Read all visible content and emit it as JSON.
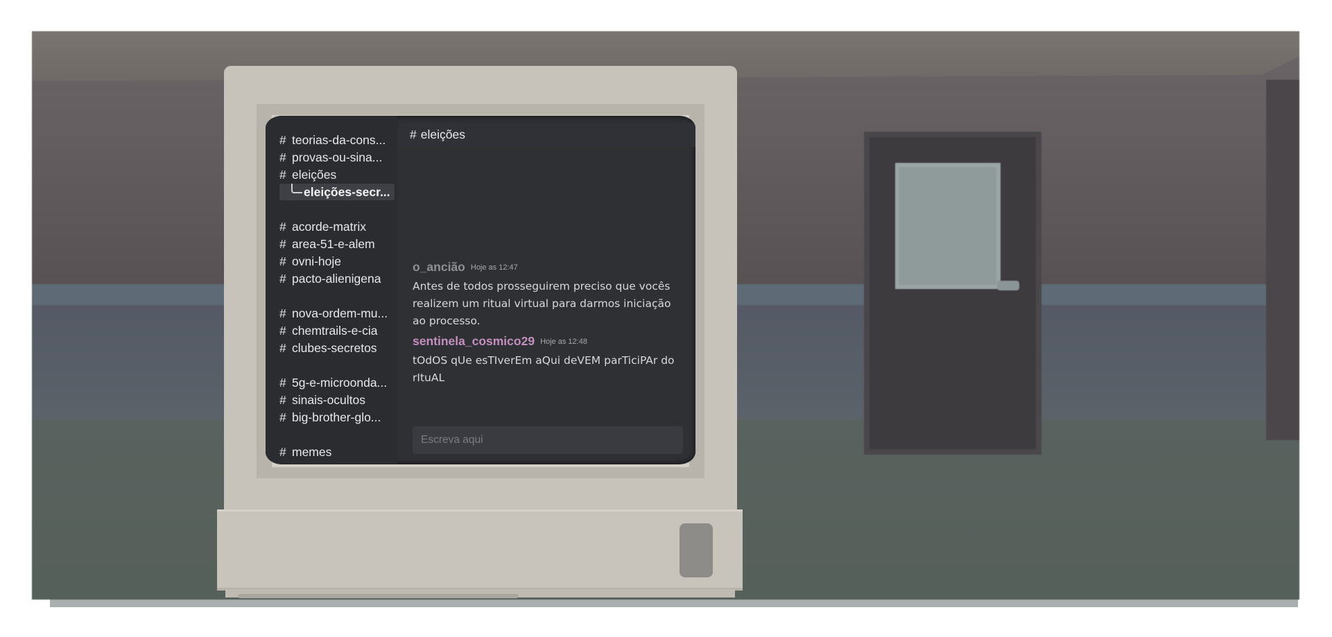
{
  "sidebar": {
    "channels": [
      {
        "hash": "#",
        "label": "teorias-da-cons..."
      },
      {
        "hash": "#",
        "label": "provas-ou-sina..."
      },
      {
        "hash": "#",
        "label": "eleições"
      },
      {
        "hash": "",
        "label": "eleições-secr..."
      },
      {
        "hash": "#",
        "label": "acorde-matrix"
      },
      {
        "hash": "#",
        "label": "area-51-e-alem"
      },
      {
        "hash": "#",
        "label": "ovni-hoje"
      },
      {
        "hash": "#",
        "label": "pacto-alienigena"
      },
      {
        "hash": "#",
        "label": "nova-ordem-mu..."
      },
      {
        "hash": "#",
        "label": "chemtrails-e-cia"
      },
      {
        "hash": "#",
        "label": "clubes-secretos"
      },
      {
        "hash": "#",
        "label": "5g-e-microonda..."
      },
      {
        "hash": "#",
        "label": "sinais-ocultos"
      },
      {
        "hash": "#",
        "label": "big-brother-glo..."
      },
      {
        "hash": "#",
        "label": "memes"
      }
    ]
  },
  "header": {
    "hash": "#",
    "channel": "eleições"
  },
  "messages": [
    {
      "author": "o_ancião",
      "time": "Hoje as 12:47",
      "author_color": "#8f9096",
      "text": "Antes de todos prosseguirem preciso que vocês realizem um ritual virtual para darmos iniciação ao processo."
    },
    {
      "author": "sentinela_cosmico29",
      "time": "Hoje as 12:48",
      "author_color": "#c48fbf",
      "text": "tOdOS qUe esTIverEm aQui deVEM parTiciPAr do rItuAL"
    }
  ],
  "composer": {
    "placeholder": "Escreva aqui"
  },
  "colors": {
    "screen": "#2f3034",
    "sidebar": "#2b2c30",
    "monitor": "#c7c3bb"
  }
}
